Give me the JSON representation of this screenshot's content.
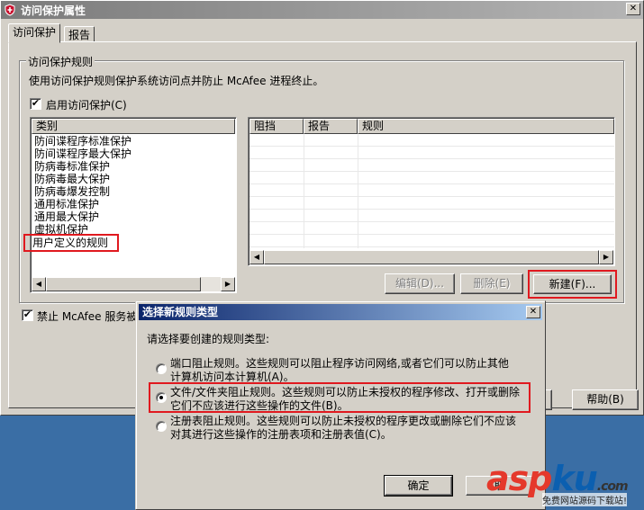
{
  "window": {
    "title": "访问保护属性",
    "tabs": [
      {
        "label": "访问保护"
      },
      {
        "label": "报告"
      }
    ],
    "group": {
      "label": "访问保护规则",
      "description": "使用访问保护规则保护系统访问点并防止 McAfee 进程终止。",
      "enable_label": "启用访问保护(C)"
    },
    "category_list": {
      "header": "类别",
      "items": [
        "防间谍程序标准保护",
        "防间谍程序最大保护",
        "防病毒标准保护",
        "防病毒最大保护",
        "防病毒爆发控制",
        "通用标准保护",
        "通用最大保护",
        "虚拟机保护",
        "用户定义的规则"
      ]
    },
    "rules_table": {
      "columns": [
        "阻挡",
        "报告",
        "规则"
      ]
    },
    "buttons": {
      "edit": "编辑(D)...",
      "delete": "删除(E)",
      "new": "新建(F)..."
    },
    "bottom_checkbox_label": "禁止 McAfee 服务被停",
    "help_button": "帮助(B)"
  },
  "dialog": {
    "title": "选择新规则类型",
    "prompt": "请选择要创建的规则类型:",
    "options": [
      {
        "line1": "端口阻止规则。这些规则可以阻止程序访问网络,或者它们可以防止其他",
        "line2": "计算机访问本计算机(A)。",
        "selected": false
      },
      {
        "line1": "文件/文件夹阻止规则。这些规则可以防止未授权的程序修改、打开或删除",
        "line2": "它们不应该进行这些操作的文件(B)。",
        "selected": true
      },
      {
        "line1": "注册表阻止规则。这些规则可以防止未授权的程序更改或删除它们不应该",
        "line2": "对其进行这些操作的注册表项和注册表值(C)。",
        "selected": false
      }
    ],
    "ok": "确定",
    "cancel": "取"
  },
  "watermark": {
    "main": "asp",
    "accent": "ku",
    "suffix": ".com",
    "sub": "免费网站源码下载站!"
  },
  "colors": {
    "highlight_red": "#e0191f",
    "dialog_title": "#0a246a",
    "desktop": "#3a6ea5"
  }
}
